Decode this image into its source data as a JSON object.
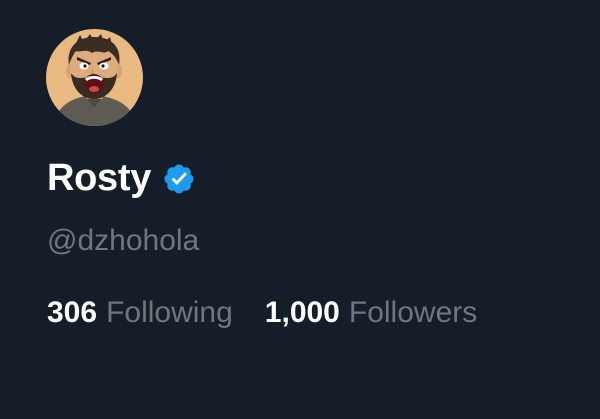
{
  "profile": {
    "display_name": "Rosty",
    "verified": true,
    "handle": "@dzhohola",
    "avatar_icon": "cartoon-avatar-shouting-man",
    "badge_icon": "verified-badge-icon",
    "colors": {
      "background": "#151d29",
      "name": "#ffffff",
      "muted": "#71767b",
      "verified_badge": "#1d9bf0",
      "avatar_backdrop": "#e8b980"
    }
  },
  "stats": {
    "following_count": "306",
    "following_label": "Following",
    "followers_count": "1,000",
    "followers_label": "Followers"
  }
}
